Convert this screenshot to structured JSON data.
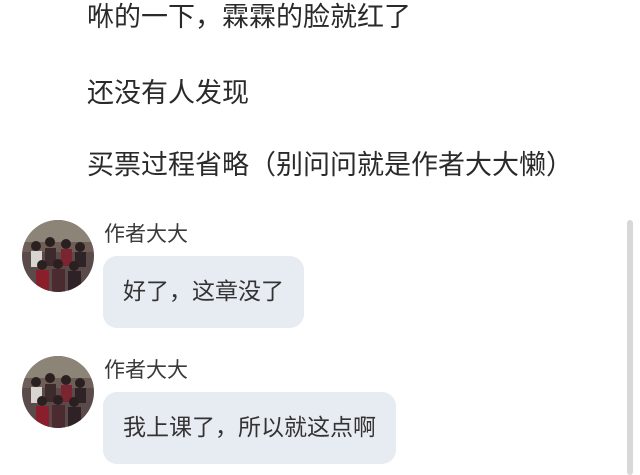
{
  "story": {
    "lines": [
      "咻的一下，霖霖的脸就红了",
      "还没有人发现",
      "买票过程省略（别问问就是作者大大懒）"
    ]
  },
  "messages": [
    {
      "author": "作者大大",
      "text": "好了，这章没了",
      "avatar_icon": "group-photo-avatar"
    },
    {
      "author": "作者大大",
      "text": "我上课了，所以就这点啊",
      "avatar_icon": "group-photo-avatar"
    }
  ],
  "colors": {
    "bubble_bg": "#e7ebf2",
    "text": "#2a2a2a",
    "scrollbar": "#d8d8d8"
  }
}
